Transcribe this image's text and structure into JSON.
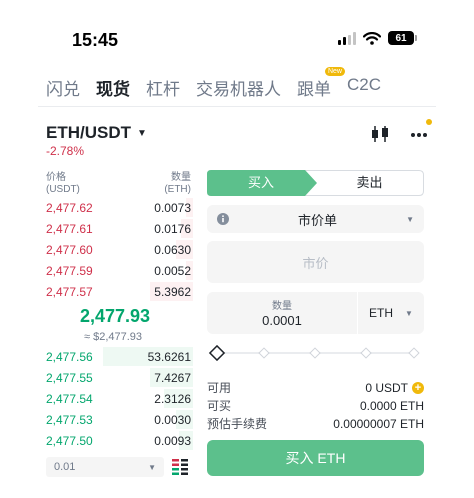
{
  "status_bar": {
    "time": "15:45",
    "battery": "61"
  },
  "tabs": [
    {
      "label": "闪兑",
      "active": false
    },
    {
      "label": "现货",
      "active": true
    },
    {
      "label": "杠杆",
      "active": false
    },
    {
      "label": "交易机器人",
      "active": false
    },
    {
      "label": "跟单",
      "active": false,
      "badge": "New"
    },
    {
      "label": "C2C",
      "active": false
    }
  ],
  "pair": {
    "symbol": "ETH/USDT",
    "change": "-2.78%"
  },
  "order_book": {
    "price_header": "价格",
    "price_unit": "(USDT)",
    "qty_header": "数量",
    "qty_unit": "(ETH)",
    "asks": [
      {
        "price": "2,477.62",
        "qty": "0.0073",
        "depth": 0.05
      },
      {
        "price": "2,477.61",
        "qty": "0.0176",
        "depth": 0.08
      },
      {
        "price": "2,477.60",
        "qty": "0.0630",
        "depth": 0.12
      },
      {
        "price": "2,477.59",
        "qty": "0.0052",
        "depth": 0.05
      },
      {
        "price": "2,477.57",
        "qty": "5.3962",
        "depth": 0.3
      }
    ],
    "mid_price": "2,477.93",
    "mid_fiat": "≈ $2,477.93",
    "bids": [
      {
        "price": "2,477.56",
        "qty": "53.6261",
        "depth": 0.62
      },
      {
        "price": "2,477.55",
        "qty": "7.4267",
        "depth": 0.3
      },
      {
        "price": "2,477.54",
        "qty": "2.3126",
        "depth": 0.2
      },
      {
        "price": "2,477.53",
        "qty": "0.0030",
        "depth": 0.12
      },
      {
        "price": "2,477.50",
        "qty": "0.0093",
        "depth": 0.1
      }
    ],
    "precision": "0.01"
  },
  "order_form": {
    "buy_tab": "买入",
    "sell_tab": "卖出",
    "order_type": "市价单",
    "price_placeholder": "市价",
    "amount_label": "数量",
    "amount_value": "0.0001",
    "amount_unit": "ETH",
    "slider_percent": 0,
    "available_label": "可用",
    "available_value": "0 USDT",
    "can_buy_label": "可买",
    "can_buy_value": "0.0000 ETH",
    "fee_label": "预估手续费",
    "fee_value": "0.00000007 ETH",
    "submit_label": "买入 ETH"
  },
  "colors": {
    "buy": "#5cc08c",
    "ask": "#cf304a",
    "bid": "#03a66d",
    "accent": "#f0b90b"
  }
}
